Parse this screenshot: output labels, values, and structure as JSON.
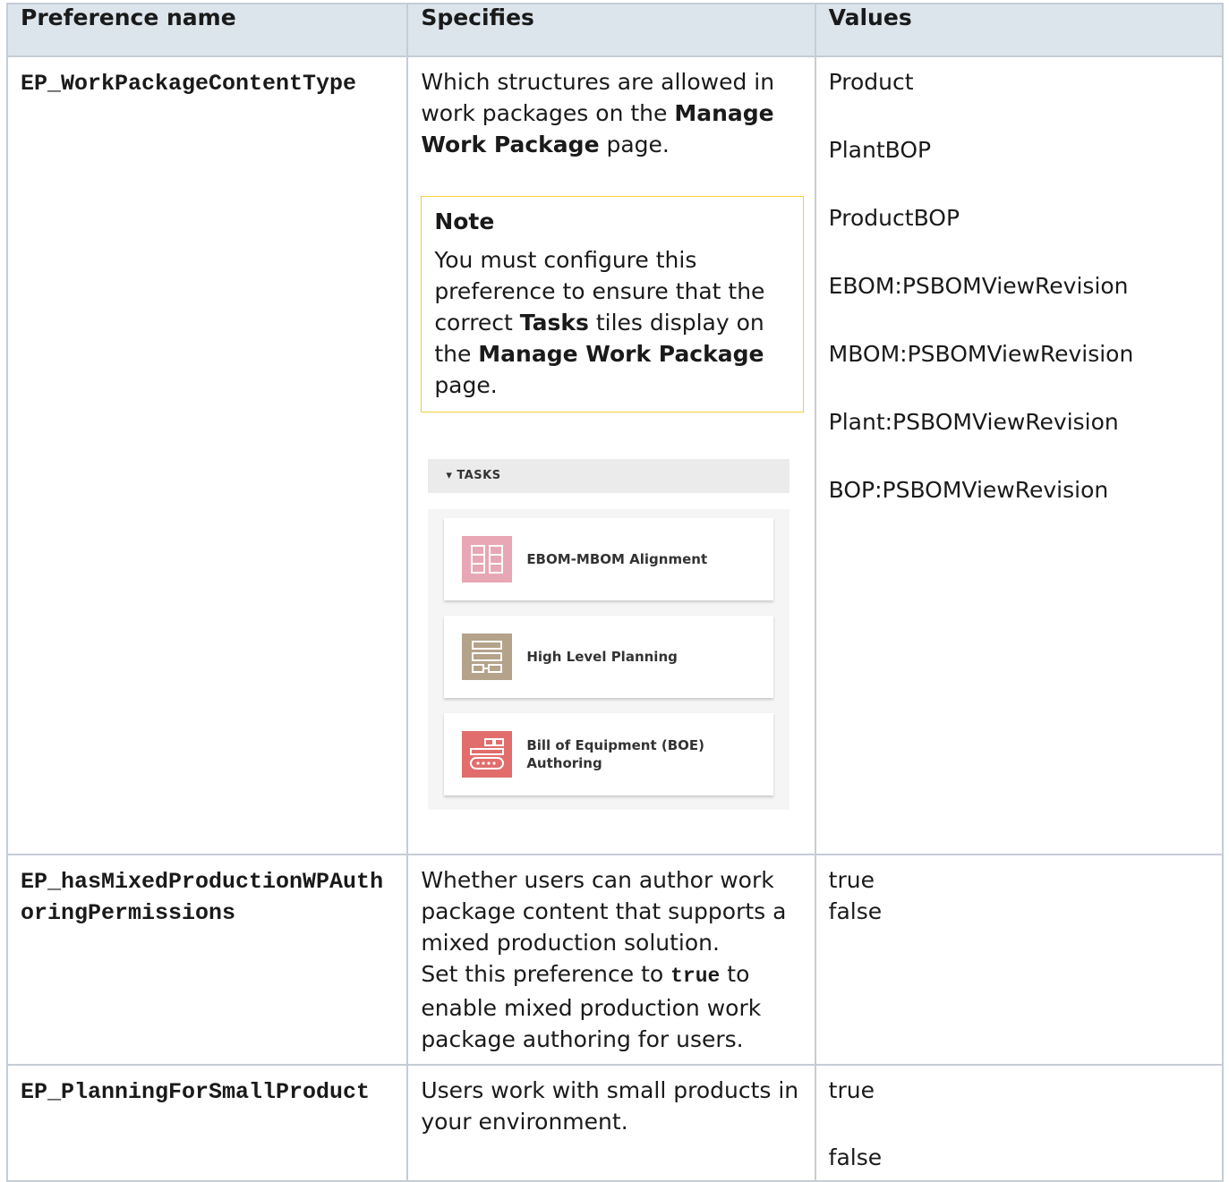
{
  "table": {
    "headers": [
      "Preference name",
      "Specifies",
      "Values"
    ],
    "rows": [
      {
        "name": "EP_WorkPackageContentType",
        "specifies": {
          "text_1": "Which structures are allowed in work packages on the ",
          "bold_1": "Manage Work Package",
          "text_2": " page.",
          "note": {
            "title": "Note",
            "text_1": "You must configure this preference to ensure that the correct ",
            "bold_1": "Tasks",
            "text_2": " tiles display on the ",
            "bold_2": "Manage Work Package",
            "text_3": " page."
          },
          "tasks_panel": {
            "header": "TASKS",
            "tiles": [
              {
                "label": "EBOM-MBOM Alignment",
                "icon": "alignment-icon",
                "color": "#e8a7b4"
              },
              {
                "label": "High Level Planning",
                "icon": "planning-icon",
                "color": "#b4a38a"
              },
              {
                "label": "Bill of Equipment (BOE) Authoring",
                "icon": "equipment-icon",
                "color": "#e26d6d"
              }
            ]
          }
        },
        "values": [
          "Product",
          "PlantBOP",
          "ProductBOP",
          "EBOM:PSBOMViewRevision",
          "MBOM:PSBOMViewRevision",
          "Plant:PSBOMViewRevision",
          "BOP:PSBOMViewRevision"
        ]
      },
      {
        "name": "EP_hasMixedProductionWPAuthoringPermissions",
        "specifies": {
          "text_1": "Whether users can author work package content that supports a mixed production solution.",
          "text_2": "Set this preference to ",
          "code_1": "true",
          "text_3": " to enable mixed production work package authoring for users."
        },
        "values": [
          "true",
          "false"
        ]
      },
      {
        "name": "EP_PlanningForSmallProduct",
        "specifies": {
          "text_1": "Users work with small products in your environment."
        },
        "values": [
          "true",
          "false"
        ]
      }
    ]
  },
  "colors": {
    "header_bg": "#dce4ec",
    "border": "#c5cdd6",
    "note_border": "#f2cf3a"
  }
}
